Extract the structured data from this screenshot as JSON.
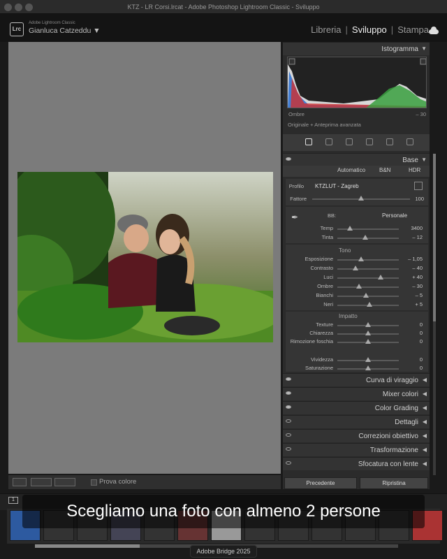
{
  "window": {
    "title": "KTZ - LR Corsi.lrcat - Adobe Photoshop Lightroom Classic - Sviluppo"
  },
  "identity": {
    "app_logo": "Lrc",
    "app_name": "Adobe Lightroom Classic",
    "user": "Gianluca Catzeddu ▼"
  },
  "modules": [
    {
      "label": "Libreria",
      "active": false
    },
    {
      "label": "Sviluppo",
      "active": true
    },
    {
      "label": "Stampa",
      "active": false
    }
  ],
  "histogram": {
    "title": "Istogramma",
    "left_label": "Ombre",
    "right_value": "– 30",
    "footer": "Originale + Anteprima avanzata"
  },
  "basic": {
    "title": "Base",
    "treatments": [
      "Automatico",
      "B&N",
      "HDR"
    ],
    "profile_label": "Profilo",
    "profile_value": "KTZLUT - Zagreb",
    "amount_label": "Fattore",
    "amount_value": "100",
    "amount_pct": 0.5,
    "wb_label": "BB:",
    "wb_value": "Personale",
    "tone_title": "Tono",
    "presence_title": "Impatto",
    "sliders_wb": [
      {
        "label": "Temp",
        "value": "3400",
        "pos": 0.2
      },
      {
        "label": "Tinta",
        "value": "– 12",
        "pos": 0.45
      }
    ],
    "sliders_tone": [
      {
        "label": "Esposizione",
        "value": "– 1,05",
        "pos": 0.39
      },
      {
        "label": "Contrasto",
        "value": "– 40",
        "pos": 0.3
      },
      {
        "label": "Luci",
        "value": "+ 40",
        "pos": 0.7
      },
      {
        "label": "Ombre",
        "value": "– 30",
        "pos": 0.35
      },
      {
        "label": "Bianchi",
        "value": "– 5",
        "pos": 0.47
      },
      {
        "label": "Neri",
        "value": "+ 5",
        "pos": 0.52
      }
    ],
    "sliders_presence": [
      {
        "label": "Texture",
        "value": "0",
        "pos": 0.5
      },
      {
        "label": "Chiarezza",
        "value": "0",
        "pos": 0.5
      },
      {
        "label": "Rimozione foschia",
        "value": "0",
        "pos": 0.5
      },
      {
        "label": "Vividezza",
        "value": "0",
        "pos": 0.5
      },
      {
        "label": "Saturazione",
        "value": "0",
        "pos": 0.5
      }
    ]
  },
  "panels": [
    {
      "label": "Curva di viraggio",
      "eye": true
    },
    {
      "label": "Mixer colori",
      "eye": true
    },
    {
      "label": "Color Grading",
      "eye": true
    },
    {
      "label": "Dettagli",
      "eye": false
    },
    {
      "label": "Correzioni obiettivo",
      "eye": false
    },
    {
      "label": "Trasformazione",
      "eye": false
    },
    {
      "label": "Sfocatura con lente",
      "eye": false
    }
  ],
  "toolbar": {
    "soft_proof_label": "Prova colore"
  },
  "bottom_buttons": {
    "previous": "Precedente",
    "reset": "Ripristina"
  },
  "filmstrip": {
    "page": "1"
  },
  "caption": "Scegliamo una foto con almeno 2 persone",
  "dock_label": "Adobe Bridge 2025",
  "colors": {
    "accent": "#e0e0e0",
    "viewer_bg": "#7b7b7b",
    "panel_bg": "#2b2b2b"
  }
}
